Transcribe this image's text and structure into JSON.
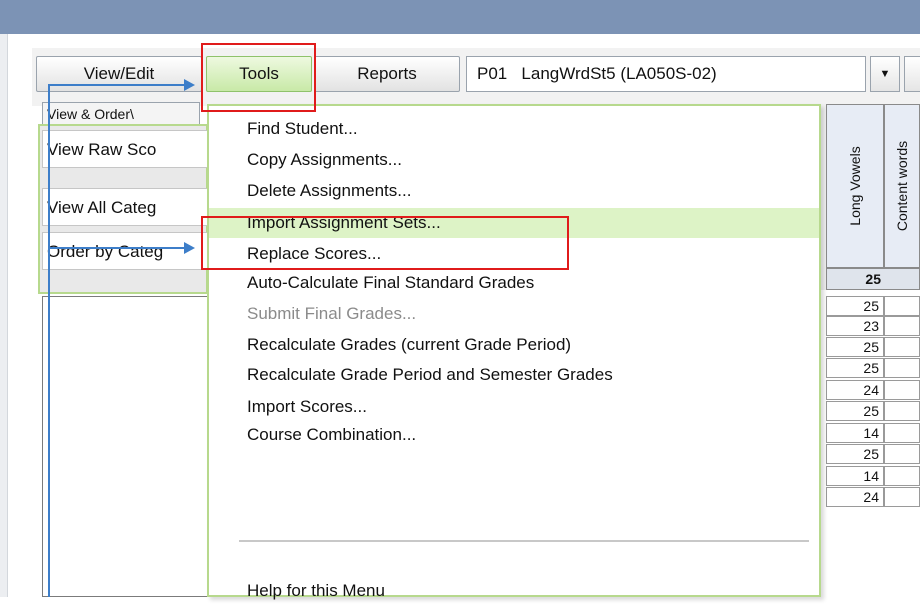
{
  "toolbar": {
    "view_edit_label": "View/Edit",
    "tools_label": "Tools",
    "reports_label": "Reports",
    "period_select_value": "P01   LangWrdSt5 (LA050S-02)"
  },
  "tab_label": "View & Order\\",
  "left_rows": [
    "View Raw Sco",
    "View All Categ",
    "Order by Categ"
  ],
  "columns": [
    {
      "label": "Long Vowels"
    },
    {
      "label": "Content words"
    }
  ],
  "max_score": "25",
  "scores": [
    "25",
    "23",
    "25",
    "25",
    "24",
    "25",
    "14",
    "25",
    "14",
    "24"
  ],
  "tools_menu": {
    "items": [
      {
        "label": "Find Student...",
        "enabled": true
      },
      {
        "label": "Copy Assignments...",
        "enabled": true
      },
      {
        "label": "Delete Assignments...",
        "enabled": true
      },
      {
        "label": "Import Assignment Sets...",
        "enabled": true,
        "highlighted": true
      },
      {
        "label": "Replace Scores...",
        "enabled": true
      },
      {
        "label": "Auto-Calculate Final Standard Grades",
        "enabled": true
      },
      {
        "label": "Submit Final Grades...",
        "enabled": false
      },
      {
        "label": "Recalculate Grades (current Grade Period)",
        "enabled": true
      },
      {
        "label": "Recalculate Grade Period and Semester Grades",
        "enabled": true
      },
      {
        "label": "Import Scores...",
        "enabled": true
      },
      {
        "label": "Course Combination...",
        "enabled": true
      },
      {
        "label": "Help for this Menu",
        "enabled": true
      }
    ]
  },
  "colors": {
    "title_bar": "#7c93b5",
    "highlight": "#ddf3c6",
    "green_border": "#b7d98d",
    "callout_red": "#e01b1b",
    "arrow_blue": "#3d7ec9"
  }
}
